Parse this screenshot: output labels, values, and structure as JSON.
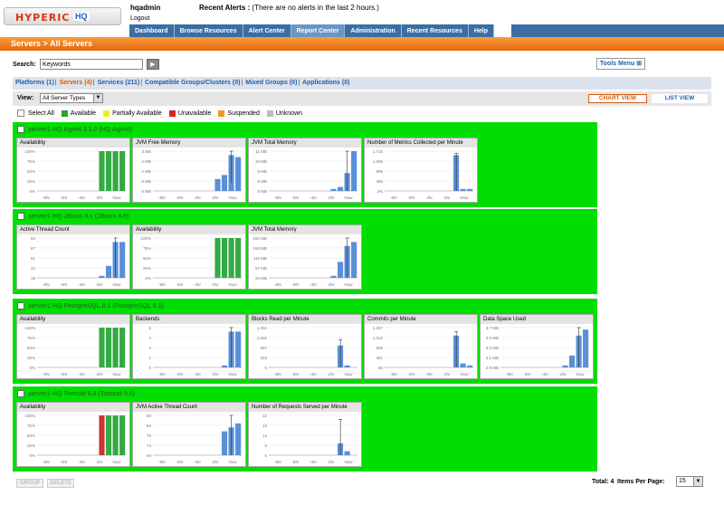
{
  "header": {
    "logo_main": "HYPERIC",
    "logo_suffix": "HQ",
    "user": "hqadmin",
    "logout": "Logout",
    "alerts_label": "Recent Alerts :",
    "alerts_text": "(There are no alerts in the last 2 hours.)"
  },
  "nav": [
    {
      "label": "Dashboard"
    },
    {
      "label": "Browse Resources"
    },
    {
      "label": "Alert Center"
    },
    {
      "label": "Report Center"
    },
    {
      "label": "Administration"
    },
    {
      "label": "Recent Resources"
    },
    {
      "label": "Help"
    }
  ],
  "breadcrumb": "Servers > All Servers",
  "search": {
    "label": "Search:",
    "value": "Keywords",
    "go": "▶"
  },
  "tools_menu": "Tools Menu",
  "resource_tabs": [
    {
      "label": "Platforms (1)",
      "current": false
    },
    {
      "label": "Servers (4)",
      "current": true
    },
    {
      "label": "Services (211)",
      "current": false
    },
    {
      "label": "Compatible Groups/Clusters (0)",
      "current": false
    },
    {
      "label": "Mixed Groups (0)",
      "current": false
    },
    {
      "label": "Applications (0)",
      "current": false
    }
  ],
  "view": {
    "label": "View:",
    "selected": "All Server Types",
    "chart_view": "CHART VIEW",
    "list_view": "LIST VIEW"
  },
  "legend": {
    "select_all": "Select All",
    "items": [
      {
        "label": "Available",
        "color": "#22aa22"
      },
      {
        "label": "Partially Available",
        "color": "#eeee22"
      },
      {
        "label": "Unavailable",
        "color": "#dd2222"
      },
      {
        "label": "Suspended",
        "color": "#ee9922"
      },
      {
        "label": "Unknown",
        "color": "#bbbbbb"
      }
    ]
  },
  "x_ticks": [
    "-8hr",
    "-6hr",
    "-4hr",
    "-2hr",
    "Now"
  ],
  "groups": [
    {
      "title": "server1 HQ Agent 3.1.0 (HQ Agent)",
      "panels": [
        {
          "title": "Availability",
          "kind": "avail",
          "ticks": [
            "100%",
            "75%",
            "50%",
            "25%",
            "0%"
          ],
          "bars": [
            0,
            0,
            0,
            0,
            0,
            0,
            0,
            0,
            0,
            1,
            1,
            1,
            1
          ],
          "bar_colors": [
            "g",
            "g",
            "g",
            "g"
          ]
        },
        {
          "title": "JVM Free Memory",
          "kind": "metric",
          "ticks": [
            "3 MB",
            "2 MB",
            "2 MB",
            "0 MB",
            "0 MB"
          ],
          "bars": [
            0,
            0,
            0,
            0,
            0,
            0,
            0,
            0,
            0,
            0.3,
            0.4,
            0.9,
            0.85
          ],
          "whisker": [
            11,
            0.2,
            1.0
          ]
        },
        {
          "title": "JVM Total Memory",
          "kind": "metric",
          "ticks": [
            "11 MB",
            "10 MB",
            "9 MB",
            "8 MB",
            "8 MB"
          ],
          "bars": [
            0,
            0,
            0,
            0,
            0,
            0,
            0,
            0,
            0,
            0.05,
            0.1,
            0.45,
            1.0
          ],
          "whisker": [
            11,
            0.0,
            1.0
          ]
        },
        {
          "title": "Number of Metrics Collected per Minute",
          "kind": "metric",
          "ticks": [
            "1,716",
            "1,306",
            "895",
            "485",
            "2%"
          ],
          "bars": [
            0,
            0,
            0,
            0,
            0,
            0,
            0,
            0,
            0,
            0,
            0.9,
            0.05,
            0.05
          ],
          "whisker": [
            10,
            0.0,
            0.95
          ]
        }
      ]
    },
    {
      "title": "server1 HQ JBoss 4.x (JBoss 4.0)",
      "panels": [
        {
          "title": "Active Thread Count",
          "kind": "metric",
          "ticks": [
            "83",
            "67",
            "51",
            "44",
            "16"
          ],
          "bars": [
            0,
            0,
            0,
            0,
            0,
            0,
            0,
            0,
            0,
            0.05,
            0.3,
            0.9,
            0.9
          ],
          "whisker": [
            11,
            0.0,
            1.0
          ]
        },
        {
          "title": "Availability",
          "kind": "avail",
          "ticks": [
            "100%",
            "75%",
            "50%",
            "25%",
            "0%"
          ],
          "bars": [
            0,
            0,
            0,
            0,
            0,
            0,
            0,
            0,
            0,
            1,
            1,
            1,
            1
          ],
          "bar_colors": [
            "g",
            "g",
            "g",
            "g"
          ]
        },
        {
          "title": "JVM Total Memory",
          "kind": "metric",
          "ticks": [
            "182 MB",
            "150 MB",
            "118 MB",
            "67 MB",
            "26 MB"
          ],
          "bars": [
            0,
            0,
            0,
            0,
            0,
            0,
            0,
            0,
            0,
            0.05,
            0.4,
            0.8,
            0.9
          ],
          "whisker": [
            11,
            0.0,
            1.0
          ]
        }
      ]
    },
    {
      "title": "server1 HQ PostgreSQL 8.1 (PostgreSQL 8.1)",
      "panels": [
        {
          "title": "Availability",
          "kind": "avail",
          "ticks": [
            "100%",
            "75%",
            "50%",
            "25%",
            "0%"
          ],
          "bars": [
            0,
            0,
            0,
            0,
            0,
            0,
            0,
            0,
            0,
            1,
            1,
            1,
            1
          ],
          "bar_colors": [
            "g",
            "g",
            "g",
            "g"
          ]
        },
        {
          "title": "Backends",
          "kind": "metric",
          "ticks": [
            "5",
            "4",
            "3",
            "1",
            "0"
          ],
          "bars": [
            0,
            0,
            0,
            0,
            0,
            0,
            0,
            0,
            0,
            0,
            0.05,
            0.9,
            0.9
          ],
          "whisker": [
            11,
            0.0,
            1.0
          ]
        },
        {
          "title": "Blocks Read per Minute",
          "kind": "metric",
          "ticks": [
            "1,334",
            "1,000",
            "667",
            "333",
            "0"
          ],
          "bars": [
            0,
            0,
            0,
            0,
            0,
            0,
            0,
            0,
            0,
            0,
            0.55,
            0.05,
            0.0
          ],
          "whisker": [
            10,
            0.0,
            0.7
          ]
        },
        {
          "title": "Commits per Minute",
          "kind": "metric",
          "ticks": [
            "1,327",
            "1,012",
            "698",
            "381",
            "65"
          ],
          "bars": [
            0,
            0,
            0,
            0,
            0,
            0,
            0,
            0,
            0,
            0,
            0.8,
            0.1,
            0.05
          ],
          "whisker": [
            10,
            0.0,
            0.9
          ]
        },
        {
          "title": "Data Space Used",
          "kind": "metric",
          "ticks": [
            "3.7 MB",
            "3.5 MB",
            "3.3 MB",
            "3.1 MB",
            "2.9 MB"
          ],
          "bars": [
            0,
            0,
            0,
            0,
            0,
            0,
            0,
            0,
            0,
            0.05,
            0.3,
            0.8,
            0.95
          ],
          "whisker": [
            11,
            0.0,
            1.0
          ]
        }
      ]
    },
    {
      "title": "server1 HQ Tomcat 5.5 (Tomcat 5.5)",
      "panels": [
        {
          "title": "Availability",
          "kind": "avail",
          "ticks": [
            "100%",
            "75%",
            "50%",
            "25%",
            "0%"
          ],
          "bars": [
            0,
            0,
            0,
            0,
            0,
            0,
            0,
            0,
            0,
            1,
            1,
            1,
            1
          ],
          "bar_colors": [
            "r",
            "g",
            "g",
            "g"
          ]
        },
        {
          "title": "JVM Active Thread Count",
          "kind": "metric",
          "ticks": [
            "89",
            "84",
            "79",
            "74",
            "69"
          ],
          "bars": [
            0,
            0,
            0,
            0,
            0,
            0,
            0,
            0,
            0,
            0,
            0.6,
            0.7,
            0.8
          ],
          "whisker": [
            11,
            0.0,
            1.0
          ]
        },
        {
          "title": "Number of Requests Served per Minute",
          "kind": "metric",
          "ticks": [
            "22",
            "18",
            "14",
            "9",
            "5"
          ],
          "bars": [
            0,
            0,
            0,
            0,
            0,
            0,
            0,
            0,
            0,
            0,
            0.3,
            0.1,
            0.0
          ],
          "whisker": [
            10,
            0.0,
            0.9
          ]
        }
      ]
    }
  ],
  "bottom": {
    "remove": "GROUP",
    "delete": "DELETE",
    "total": "Total: 4",
    "items_per_page": "Items Per Page:",
    "page_size": "15"
  }
}
